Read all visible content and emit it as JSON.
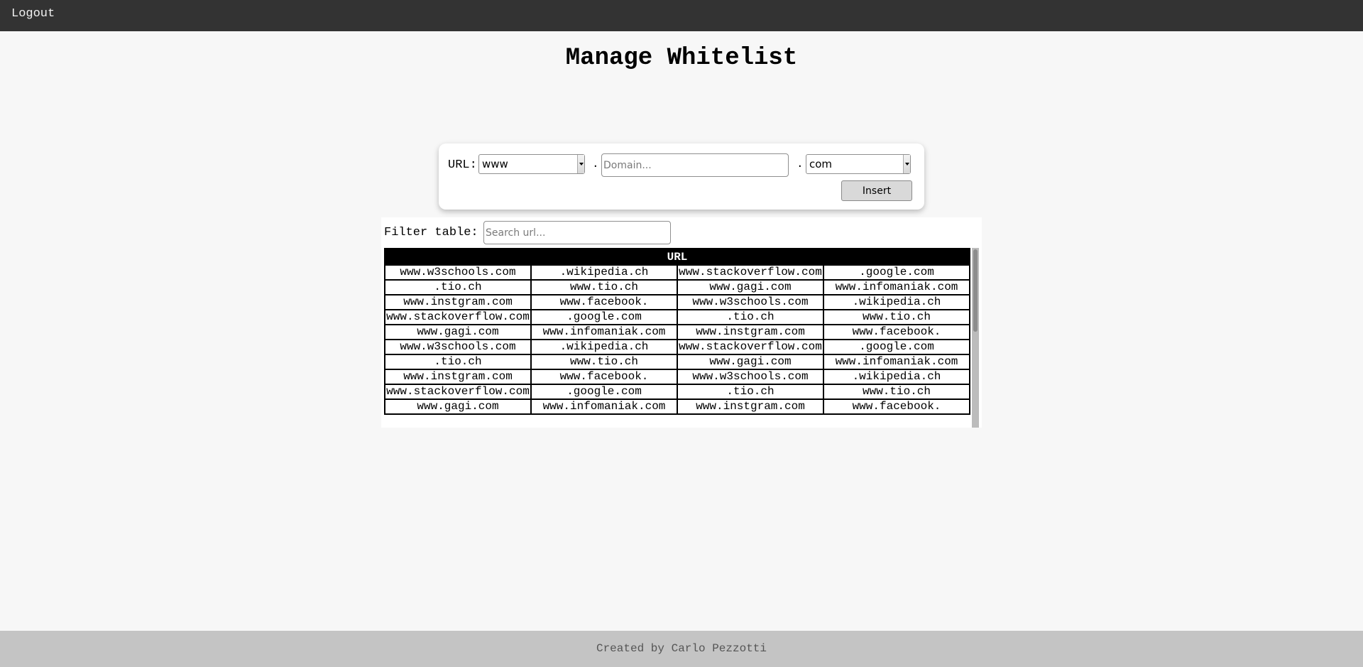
{
  "topbar": {
    "logout_label": "Logout"
  },
  "page_title": "Manage Whitelist",
  "url_form": {
    "label": "URL:",
    "prefix_selected": "www",
    "separator": ".",
    "domain_placeholder": "Domain...",
    "domain_value": "",
    "tld_selected": "com",
    "insert_label": "Insert"
  },
  "filter": {
    "label": "Filter table:",
    "placeholder": "Search url...",
    "value": ""
  },
  "table": {
    "header": "URL",
    "rows": [
      [
        "www.w3schools.com",
        ".wikipedia.ch",
        "www.stackoverflow.com",
        ".google.com"
      ],
      [
        ".tio.ch",
        "www.tio.ch",
        "www.gagi.com",
        "www.infomaniak.com"
      ],
      [
        "www.instgram.com",
        "www.facebook.",
        "www.w3schools.com",
        ".wikipedia.ch"
      ],
      [
        "www.stackoverflow.com",
        ".google.com",
        ".tio.ch",
        "www.tio.ch"
      ],
      [
        "www.gagi.com",
        "www.infomaniak.com",
        "www.instgram.com",
        "www.facebook."
      ],
      [
        "www.w3schools.com",
        ".wikipedia.ch",
        "www.stackoverflow.com",
        ".google.com"
      ],
      [
        ".tio.ch",
        "www.tio.ch",
        "www.gagi.com",
        "www.infomaniak.com"
      ],
      [
        "www.instgram.com",
        "www.facebook.",
        "www.w3schools.com",
        ".wikipedia.ch"
      ],
      [
        "www.stackoverflow.com",
        ".google.com",
        ".tio.ch",
        "www.tio.ch"
      ],
      [
        "www.gagi.com",
        "www.infomaniak.com",
        "www.instgram.com",
        "www.facebook."
      ]
    ]
  },
  "footer": {
    "text": "Created by Carlo Pezzotti"
  },
  "colors": {
    "topbar": "#333333",
    "background": "#f7f7f7",
    "table_header": "#000000",
    "footer": "#c4c4c4"
  }
}
